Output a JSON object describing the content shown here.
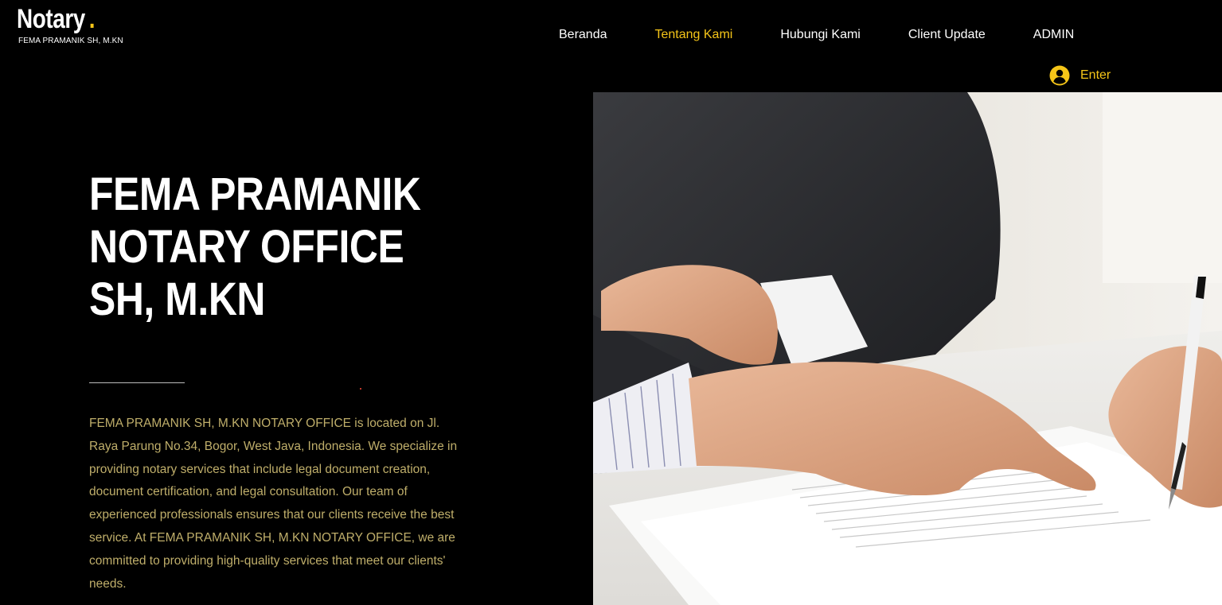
{
  "header": {
    "logo_title": "Notary",
    "logo_dot": ".",
    "logo_subtitle": "FEMA PRAMANIK SH, M.KN"
  },
  "nav": {
    "items": [
      {
        "label": "Beranda",
        "active": false
      },
      {
        "label": "Tentang Kami",
        "active": true
      },
      {
        "label": "Hubungi Kami",
        "active": false
      },
      {
        "label": "Client Update",
        "active": false
      },
      {
        "label": "ADMIN",
        "active": false
      }
    ]
  },
  "login": {
    "label": "Enter",
    "icon": "user-circle-icon"
  },
  "hero": {
    "title": "FEMA PRAMANIK NOTARY OFFICE SH, M.KN",
    "description": "FEMA PRAMANIK SH, M.KN NOTARY OFFICE is located on Jl. Raya Parung No.34, Bogor, West Java, Indonesia. We specialize in providing notary services that include legal document creation, document certification, and legal consultation. Our team of experienced professionals ensures that our clients receive the best service. At FEMA PRAMANIK SH, M.KN NOTARY OFFICE, we are committed to providing high-quality services that meet our clients' needs."
  },
  "colors": {
    "accent": "#f5c518",
    "background": "#000000",
    "description_text": "#bfae6a"
  }
}
